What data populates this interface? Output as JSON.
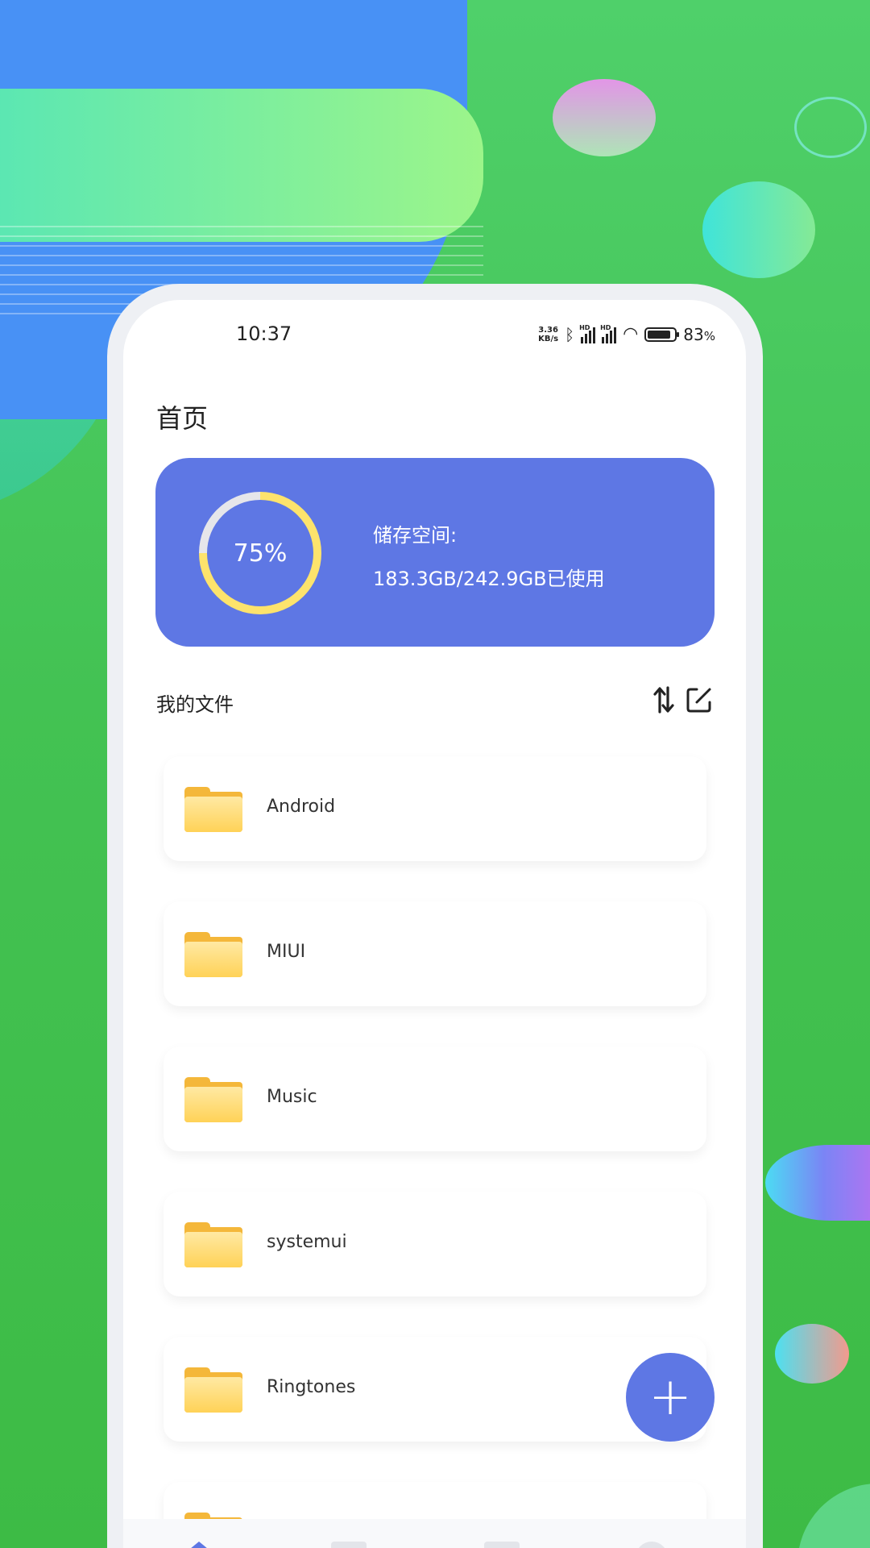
{
  "status_bar": {
    "time": "10:37",
    "net_speed_value": "3.36",
    "net_speed_unit": "KB/s",
    "hd_label": "HD",
    "battery_percent": "83",
    "battery_unit": "%",
    "icons": [
      "bluetooth-icon",
      "signal-icon",
      "signal-icon",
      "wifi-icon",
      "battery-icon"
    ]
  },
  "header": {
    "title": "首页"
  },
  "storage": {
    "percent_label": "75%",
    "percent_value": 75,
    "label": "储存空间:",
    "usage": "183.3GB/242.9GB已使用",
    "colors": {
      "card": "#5e77e4",
      "ring_used": "#fde36c",
      "ring_free": "#e6e6ea"
    }
  },
  "files_section": {
    "title": "我的文件",
    "sort_icon": "sort-icon",
    "edit_icon": "edit-icon"
  },
  "files": [
    {
      "name": "Android"
    },
    {
      "name": "MIUI"
    },
    {
      "name": "Music"
    },
    {
      "name": "systemui"
    },
    {
      "name": "Ringtones"
    },
    {
      "name": ""
    }
  ],
  "fab": {
    "icon": "plus-icon",
    "symbol": "+"
  },
  "bottom_nav": {
    "items": [
      "home-icon",
      "file-icon",
      "folder-icon",
      "profile-icon"
    ],
    "active_color": "#5e77e4"
  }
}
